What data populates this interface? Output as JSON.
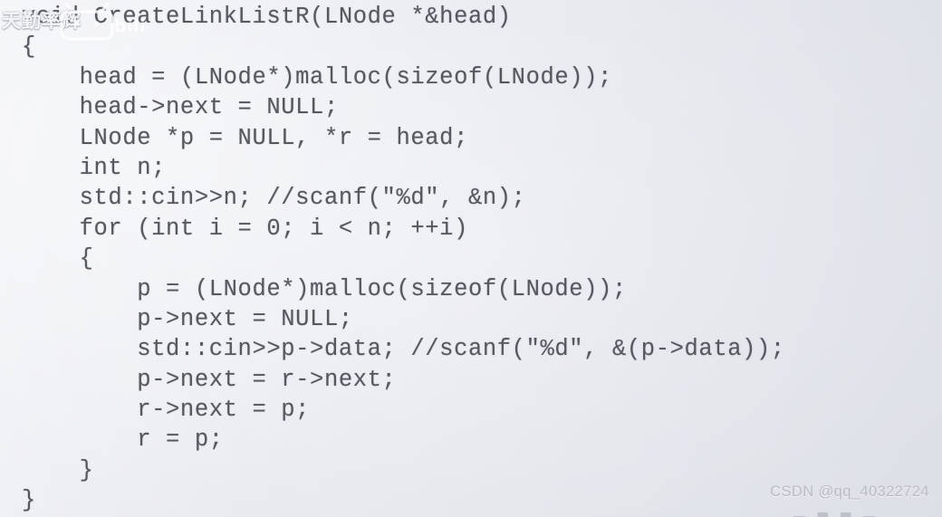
{
  "slide": {
    "background_color": "#e6e8ee",
    "text_color": "#55585e",
    "language": "cpp",
    "code_lines": [
      "void CreateLinkListR(LNode *&head)",
      "{",
      "    head = (LNode*)malloc(sizeof(LNode));",
      "    head->next = NULL;",
      "    LNode *p = NULL, *r = head;",
      "    int n;",
      "    std::cin>>n; //scanf(\"%d\", &n);",
      "    for (int i = 0; i < n; ++i)",
      "    {",
      "        p = (LNode*)malloc(sizeof(LNode));",
      "        p->next = NULL;",
      "        std::cin>>p->data; //scanf(\"%d\", &(p->data));",
      "        p->next = r->next;",
      "        r->next = p;",
      "        r = p;",
      "    }",
      "}"
    ]
  },
  "watermarks": {
    "channel": {
      "text": "天勤率辉",
      "color": "#fafbfd"
    },
    "bilibili": {
      "text": "bilibili",
      "color": "#ffffff"
    },
    "csdn": {
      "text": "CSDN @qq_40322724",
      "color": "#b9bcc4"
    },
    "bottom_fragment": {
      "text": "— ■ ■ —"
    }
  }
}
